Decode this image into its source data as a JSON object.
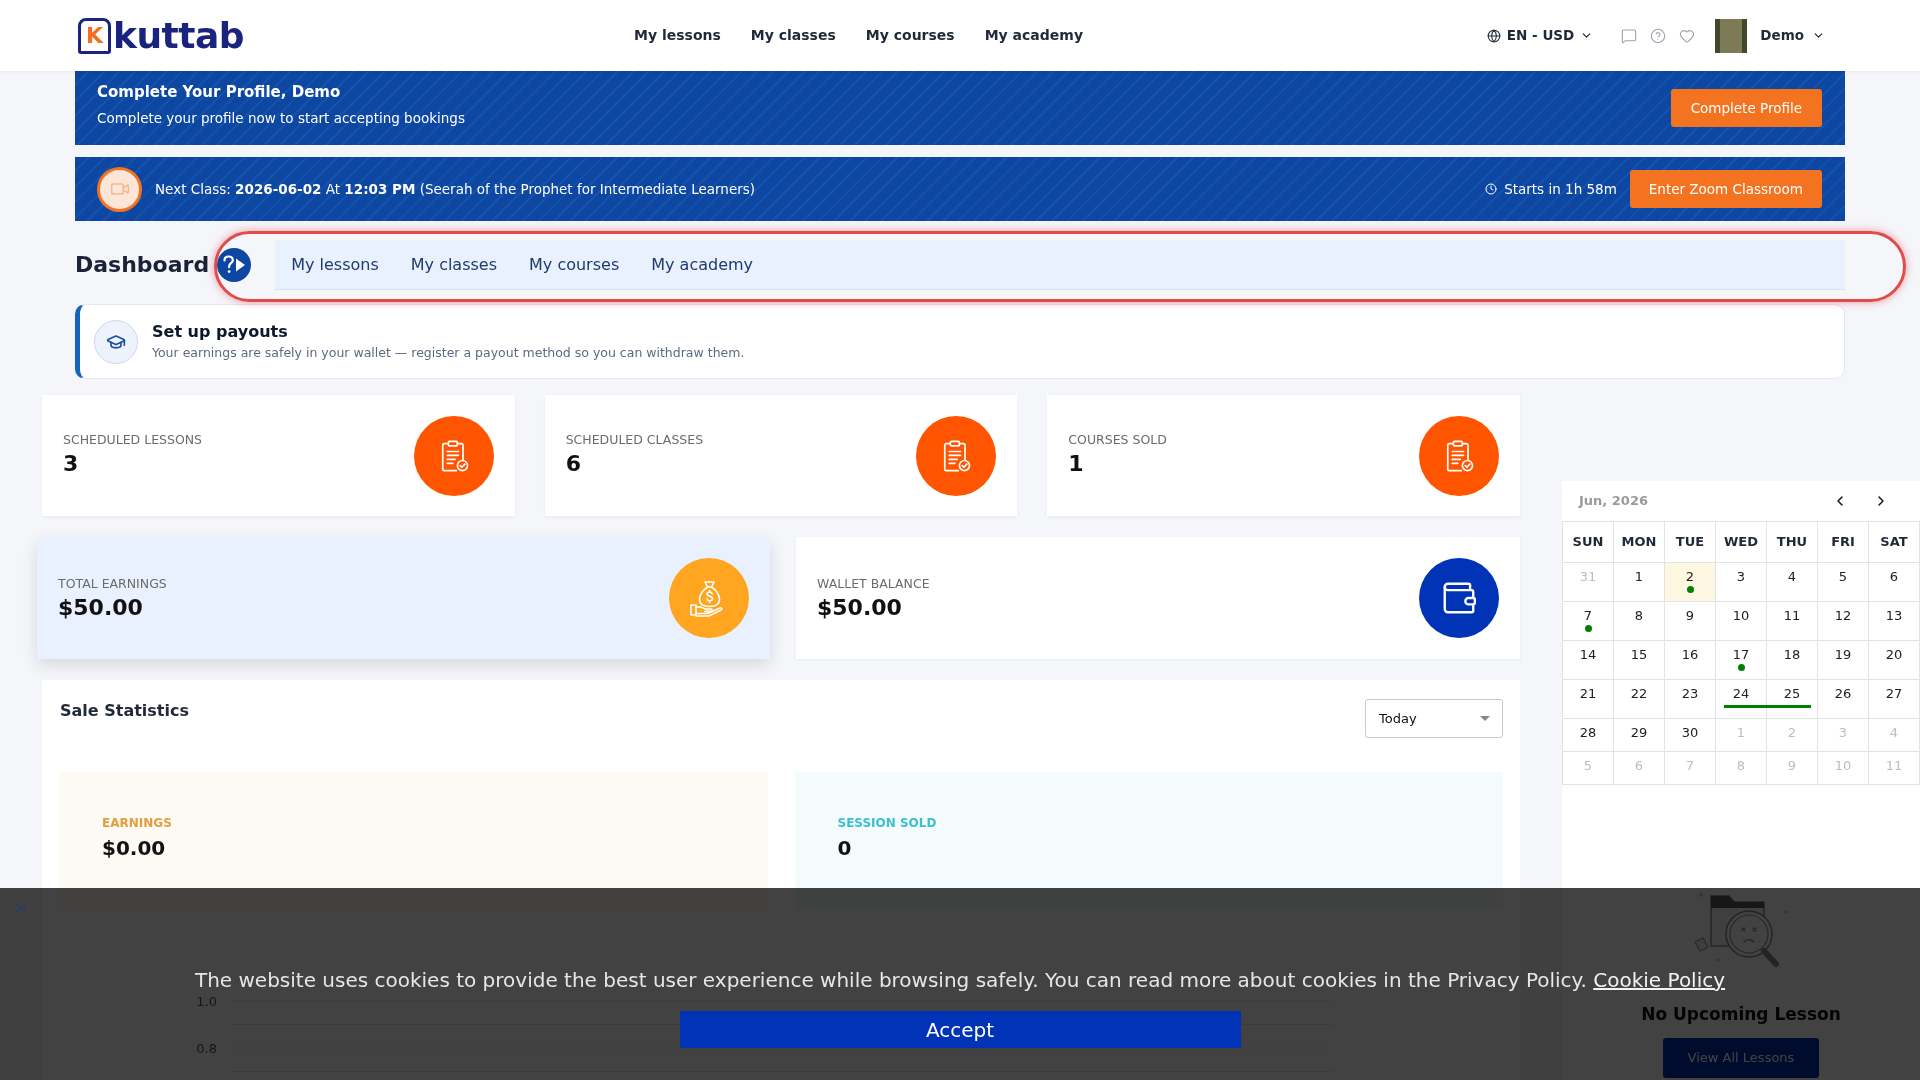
{
  "header": {
    "logo_mark": "K",
    "logo": "kuttab",
    "nav": [
      "My lessons",
      "My classes",
      "My courses",
      "My academy"
    ],
    "locale": "EN - USD",
    "user": "Demo"
  },
  "profile_banner": {
    "title": "Complete Your Profile, Demo",
    "text": "Complete your profile now to start accepting bookings",
    "button": "Complete Profile"
  },
  "next_class_banner": {
    "text": "Next Class: **2026-06-02** At **12:03 PM** (Seerah of the Prophet for Intermediate Learners)",
    "countdown": "Starts in 1h 58m",
    "button": "Enter Zoom Classroom"
  },
  "dashboard": {
    "title": "Dashboard",
    "tabs": [
      {
        "label": "My lessons",
        "selected": false
      },
      {
        "label": "My classes",
        "selected": false
      },
      {
        "label": "My courses",
        "selected": false
      },
      {
        "label": "My academy",
        "selected": false
      }
    ]
  },
  "payout_notice": {
    "title": "Set up payouts",
    "text": "Your earnings are safely in your wallet — register a payout method so you can withdraw them."
  },
  "stats": [
    {
      "label": "SCHEDULED LESSONS",
      "value": "3",
      "kind": "clipboard"
    },
    {
      "label": "SCHEDULED CLASSES",
      "value": "6",
      "kind": "clipboard"
    },
    {
      "label": "COURSES SOLD",
      "value": "1",
      "kind": "clipboard"
    }
  ],
  "balances": [
    {
      "label": "TOTAL EARNINGS",
      "value": "$50.00",
      "kind": "money-bag",
      "color": "#ffa51f",
      "highlighted": true
    },
    {
      "label": "WALLET BALANCE",
      "value": "$50.00",
      "kind": "wallet",
      "color": "#0033b5",
      "highlighted": false
    }
  ],
  "sale_statistics": {
    "title": "Sale Statistics",
    "period": "Today",
    "summary": [
      {
        "label": "EARNINGS",
        "value": "$0.00",
        "color": "#e0a040"
      },
      {
        "label": "SESSION SOLD",
        "value": "0",
        "color": "#3bbfcf"
      }
    ],
    "chart": {
      "y_tick_labels": [
        "1.0",
        "0.8"
      ]
    }
  },
  "calendar": {
    "month": "Jun, 2026",
    "weekdays": [
      "SUN",
      "MON",
      "TUE",
      "WED",
      "THU",
      "FRI",
      "SAT"
    ],
    "weeks": [
      [
        {
          "day": "31",
          "outside": true,
          "today": false,
          "event": false,
          "bar": false
        },
        {
          "day": "1",
          "outside": false,
          "today": false,
          "event": false,
          "bar": false
        },
        {
          "day": "2",
          "outside": false,
          "today": true,
          "event": true,
          "bar": false
        },
        {
          "day": "3",
          "outside": false,
          "today": false,
          "event": false,
          "bar": false
        },
        {
          "day": "4",
          "outside": false,
          "today": false,
          "event": false,
          "bar": false
        },
        {
          "day": "5",
          "outside": false,
          "today": false,
          "event": false,
          "bar": false
        },
        {
          "day": "6",
          "outside": false,
          "today": false,
          "event": false,
          "bar": false
        }
      ],
      [
        {
          "day": "7",
          "outside": false,
          "today": false,
          "event": true,
          "bar": false
        },
        {
          "day": "8",
          "outside": false,
          "today": false,
          "event": false,
          "bar": false
        },
        {
          "day": "9",
          "outside": false,
          "today": false,
          "event": false,
          "bar": false
        },
        {
          "day": "10",
          "outside": false,
          "today": false,
          "event": false,
          "bar": false
        },
        {
          "day": "11",
          "outside": false,
          "today": false,
          "event": false,
          "bar": false
        },
        {
          "day": "12",
          "outside": false,
          "today": false,
          "event": false,
          "bar": false
        },
        {
          "day": "13",
          "outside": false,
          "today": false,
          "event": false,
          "bar": false
        }
      ],
      [
        {
          "day": "14",
          "outside": false,
          "today": false,
          "event": false,
          "bar": false
        },
        {
          "day": "15",
          "outside": false,
          "today": false,
          "event": false,
          "bar": false
        },
        {
          "day": "16",
          "outside": false,
          "today": false,
          "event": false,
          "bar": false
        },
        {
          "day": "17",
          "outside": false,
          "today": false,
          "event": true,
          "bar": false
        },
        {
          "day": "18",
          "outside": false,
          "today": false,
          "event": false,
          "bar": false
        },
        {
          "day": "19",
          "outside": false,
          "today": false,
          "event": false,
          "bar": false
        },
        {
          "day": "20",
          "outside": false,
          "today": false,
          "event": false,
          "bar": false
        }
      ],
      [
        {
          "day": "21",
          "outside": false,
          "today": false,
          "event": false,
          "bar": false
        },
        {
          "day": "22",
          "outside": false,
          "today": false,
          "event": false,
          "bar": false
        },
        {
          "day": "23",
          "outside": false,
          "today": false,
          "event": false,
          "bar": false
        },
        {
          "day": "24",
          "outside": false,
          "today": false,
          "event": false,
          "bar": true
        },
        {
          "day": "25",
          "outside": false,
          "today": false,
          "event": false,
          "bar": true
        },
        {
          "day": "26",
          "outside": false,
          "today": false,
          "event": false,
          "bar": false
        },
        {
          "day": "27",
          "outside": false,
          "today": false,
          "event": false,
          "bar": false
        }
      ],
      [
        {
          "day": "28",
          "outside": false,
          "today": false,
          "event": false,
          "bar": false
        },
        {
          "day": "29",
          "outside": false,
          "today": false,
          "event": false,
          "bar": false
        },
        {
          "day": "30",
          "outside": false,
          "today": false,
          "event": false,
          "bar": false
        },
        {
          "day": "1",
          "outside": true,
          "today": false,
          "event": false,
          "bar": false
        },
        {
          "day": "2",
          "outside": true,
          "today": false,
          "event": false,
          "bar": false
        },
        {
          "day": "3",
          "outside": true,
          "today": false,
          "event": false,
          "bar": false
        },
        {
          "day": "4",
          "outside": true,
          "today": false,
          "event": false,
          "bar": false
        }
      ],
      [
        {
          "day": "5",
          "outside": true,
          "today": false,
          "event": false,
          "bar": false
        },
        {
          "day": "6",
          "outside": true,
          "today": false,
          "event": false,
          "bar": false
        },
        {
          "day": "7",
          "outside": true,
          "today": false,
          "event": false,
          "bar": false
        },
        {
          "day": "8",
          "outside": true,
          "today": false,
          "event": false,
          "bar": false
        },
        {
          "day": "9",
          "outside": true,
          "today": false,
          "event": false,
          "bar": false
        },
        {
          "day": "10",
          "outside": true,
          "today": false,
          "event": false,
          "bar": false
        },
        {
          "day": "11",
          "outside": true,
          "today": false,
          "event": false,
          "bar": false
        }
      ]
    ]
  },
  "upcoming": {
    "message": "No Upcoming Lesson",
    "button": "View All Lessons"
  },
  "cookie_banner": {
    "text": "The website uses cookies to provide the best user experience while browsing safely. You can read more about cookies in the Privacy Policy.",
    "link": "Cookie Policy",
    "button": "Accept"
  }
}
